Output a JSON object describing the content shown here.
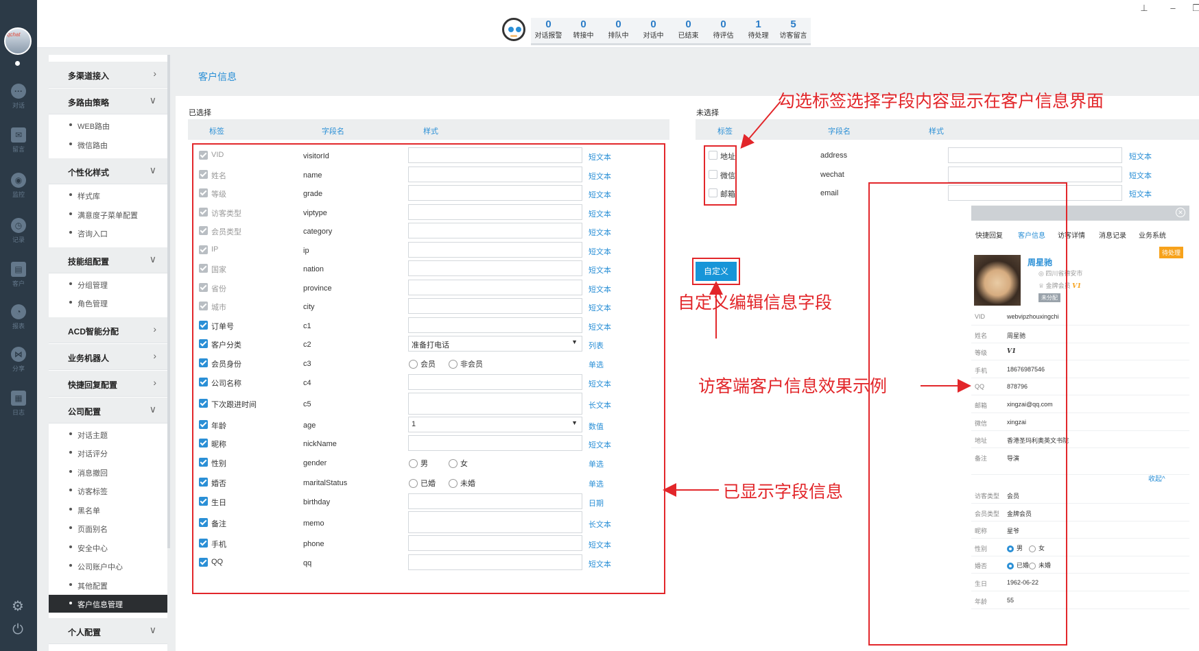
{
  "rail": {
    "items": [
      {
        "icon": "chat-bubble-icon",
        "label": "对话"
      },
      {
        "icon": "envelope-icon",
        "label": "留言"
      },
      {
        "icon": "eye-icon",
        "label": "监控"
      },
      {
        "icon": "clock-icon",
        "label": "记录"
      },
      {
        "icon": "contact-card-icon",
        "label": "客户"
      },
      {
        "icon": "pie-chart-icon",
        "label": "报表"
      },
      {
        "icon": "share-icon",
        "label": "分享"
      },
      {
        "icon": "log-icon",
        "label": "日志"
      }
    ],
    "avatar_tag": "qchat"
  },
  "topbar": {
    "stats": [
      {
        "value": "0",
        "label": "对话报警"
      },
      {
        "value": "0",
        "label": "转接中"
      },
      {
        "value": "0",
        "label": "排队中"
      },
      {
        "value": "0",
        "label": "对话中"
      },
      {
        "value": "0",
        "label": "已结束"
      },
      {
        "value": "0",
        "label": "待评估"
      },
      {
        "value": "1",
        "label": "待处理"
      },
      {
        "value": "5",
        "label": "访客留言"
      }
    ]
  },
  "nav": {
    "sections": [
      {
        "title": "多渠道接入",
        "arrow": ">"
      },
      {
        "title": "多路由策略",
        "arrow": "v",
        "items": [
          "WEB路由",
          "微信路由"
        ]
      },
      {
        "title": "个性化样式",
        "arrow": "v",
        "items": [
          "样式库",
          "满意度子菜单配置",
          "咨询入口"
        ]
      },
      {
        "title": "技能组配置",
        "arrow": "v",
        "items": [
          "分组管理",
          "角色管理"
        ]
      },
      {
        "title": "ACD智能分配",
        "arrow": ">"
      },
      {
        "title": "业务机器人",
        "arrow": ">"
      },
      {
        "title": "快捷回复配置",
        "arrow": ">"
      },
      {
        "title": "公司配置",
        "arrow": "v",
        "items": [
          "对话主题",
          "对话评分",
          "消息撤回",
          "访客标签",
          "黑名单",
          "页面别名",
          "安全中心",
          "公司账户中心",
          "其他配置",
          "客户信息管理"
        ]
      },
      {
        "title": "个人配置",
        "arrow": "v",
        "items": [
          "个人配置中心",
          "个人账户中心"
        ]
      }
    ],
    "active_item": "客户信息管理"
  },
  "page": {
    "title": "客户信息",
    "selected_title": "已选择",
    "unselected_title": "未选择",
    "columns": [
      "标签",
      "字段名",
      "样式"
    ],
    "custom_button": "自定义"
  },
  "selected_fields": [
    {
      "label": "VID",
      "field": "visitorId",
      "style": "短文本",
      "state": "locked",
      "kind": "text",
      "value": ""
    },
    {
      "label": "姓名",
      "field": "name",
      "style": "短文本",
      "state": "locked",
      "kind": "text",
      "value": ""
    },
    {
      "label": "等级",
      "field": "grade",
      "style": "短文本",
      "state": "locked",
      "kind": "text",
      "value": ""
    },
    {
      "label": "访客类型",
      "field": "viptype",
      "style": "短文本",
      "state": "locked",
      "kind": "text",
      "value": ""
    },
    {
      "label": "会员类型",
      "field": "category",
      "style": "短文本",
      "state": "locked",
      "kind": "text",
      "value": ""
    },
    {
      "label": "IP",
      "field": "ip",
      "style": "短文本",
      "state": "locked",
      "kind": "text",
      "value": ""
    },
    {
      "label": "国家",
      "field": "nation",
      "style": "短文本",
      "state": "locked",
      "kind": "text",
      "value": ""
    },
    {
      "label": "省份",
      "field": "province",
      "style": "短文本",
      "state": "locked",
      "kind": "text",
      "value": ""
    },
    {
      "label": "城市",
      "field": "city",
      "style": "短文本",
      "state": "locked",
      "kind": "text",
      "value": ""
    },
    {
      "label": "订单号",
      "field": "c1",
      "style": "短文本",
      "state": "on",
      "kind": "text",
      "value": ""
    },
    {
      "label": "客户分类",
      "field": "c2",
      "style": "列表",
      "state": "on",
      "kind": "select",
      "value": "准备打电话"
    },
    {
      "label": "会员身份",
      "field": "c3",
      "style": "单选",
      "state": "on",
      "kind": "radio",
      "options": [
        "会员",
        "非会员"
      ]
    },
    {
      "label": "公司名称",
      "field": "c4",
      "style": "短文本",
      "state": "on",
      "kind": "text",
      "value": ""
    },
    {
      "label": "下次跟进时间",
      "field": "c5",
      "style": "长文本",
      "state": "on",
      "kind": "textarea",
      "value": ""
    },
    {
      "label": "年龄",
      "field": "age",
      "style": "数值",
      "state": "on",
      "kind": "select",
      "value": "1"
    },
    {
      "label": "昵称",
      "field": "nickName",
      "style": "短文本",
      "state": "on",
      "kind": "text",
      "value": ""
    },
    {
      "label": "性别",
      "field": "gender",
      "style": "单选",
      "state": "on",
      "kind": "radio",
      "options": [
        "男",
        "女"
      ]
    },
    {
      "label": "婚否",
      "field": "maritalStatus",
      "style": "单选",
      "state": "on",
      "kind": "radio",
      "options": [
        "已婚",
        "未婚"
      ]
    },
    {
      "label": "生日",
      "field": "birthday",
      "style": "日期",
      "state": "on",
      "kind": "text",
      "value": ""
    },
    {
      "label": "备注",
      "field": "memo",
      "style": "长文本",
      "state": "on",
      "kind": "textarea",
      "value": ""
    },
    {
      "label": "手机",
      "field": "phone",
      "style": "短文本",
      "state": "on",
      "kind": "text",
      "value": ""
    },
    {
      "label": "QQ",
      "field": "qq",
      "style": "短文本",
      "state": "on",
      "kind": "text",
      "value": ""
    }
  ],
  "unselected_fields": [
    {
      "label": "地址",
      "field": "address",
      "style": "短文本"
    },
    {
      "label": "微信",
      "field": "wechat",
      "style": "短文本"
    },
    {
      "label": "邮箱",
      "field": "email",
      "style": "短文本"
    }
  ],
  "annotations": {
    "check_tip": "勾选标签选择字段内容显示在客户信息界面",
    "custom_tip": "自定义编辑信息字段",
    "preview_tip": "访客端客户信息效果示例",
    "shown_tip": "已显示字段信息"
  },
  "preview": {
    "tabs": [
      "快捷回复",
      "客户信息",
      "访客详情",
      "消息记录",
      "业务系统"
    ],
    "active_tab": "客户信息",
    "name": "周星驰",
    "location": "四川省德安市",
    "member": "金牌会员",
    "vip_badge": "V1",
    "assign": "未分配",
    "status_badge": "待处理",
    "rows": [
      {
        "k": "VID",
        "v": "webvipzhouxingchi"
      },
      {
        "k": "姓名",
        "v": "周星驰"
      },
      {
        "k": "等级",
        "v": "V1"
      },
      {
        "k": "手机",
        "v": "18676987546"
      },
      {
        "k": "QQ",
        "v": "878796"
      },
      {
        "k": "邮箱",
        "v": "xingzai@qq.com"
      },
      {
        "k": "微信",
        "v": "xingzai"
      },
      {
        "k": "地址",
        "v": "香港圣玛利奥英文书院"
      },
      {
        "k": "备注",
        "v": "导演"
      }
    ],
    "collapse": "收起^",
    "rows2": [
      {
        "k": "访客类型",
        "v": "会员"
      },
      {
        "k": "会员类型",
        "v": "金牌会员"
      },
      {
        "k": "昵称",
        "v": "星爷"
      },
      {
        "k": "性别",
        "v": "男 / 女",
        "radio": [
          "男",
          "女"
        ]
      },
      {
        "k": "婚否",
        "v": "已婚 / 未婚",
        "radio": [
          "已婚",
          "未婚"
        ]
      },
      {
        "k": "生日",
        "v": "1962-06-22"
      },
      {
        "k": "年龄",
        "v": "55"
      }
    ]
  },
  "colors": {
    "accent": "#2a8fd6",
    "annotation": "#e2262a",
    "rail": "#2c3a47"
  }
}
